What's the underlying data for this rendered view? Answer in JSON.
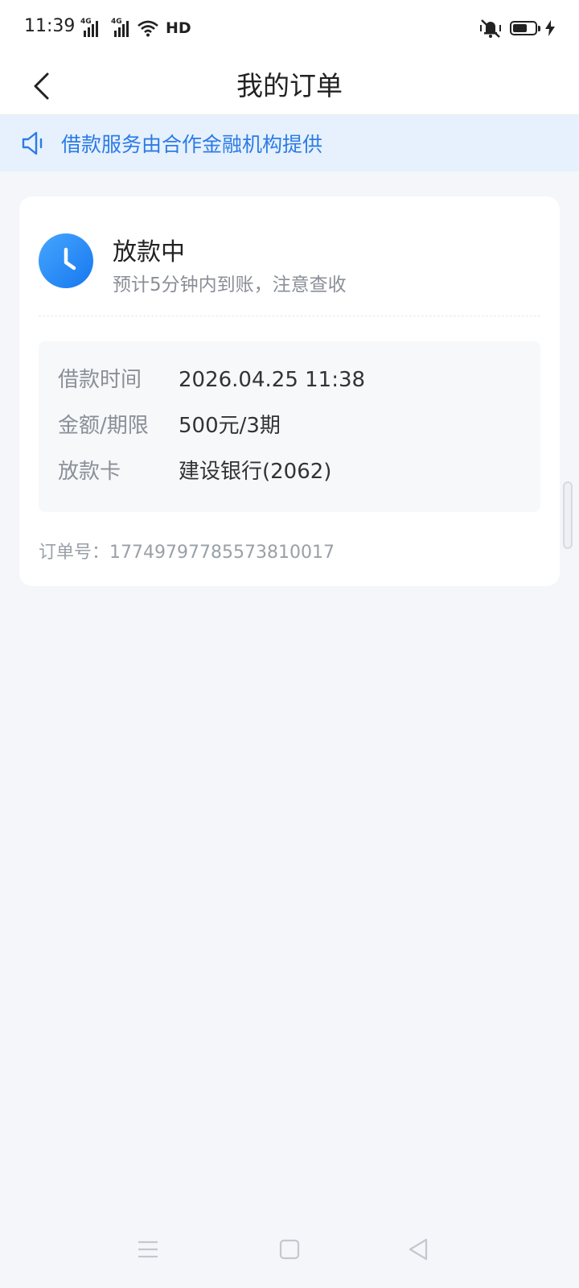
{
  "status_bar": {
    "time": "11:39",
    "network_1": "4G",
    "network_2": "4G",
    "hd": "HD",
    "battery_level": 0.65
  },
  "header": {
    "title": "我的订单"
  },
  "notice": {
    "text": "借款服务由合作金融机构提供"
  },
  "order": {
    "status_title": "放款中",
    "status_subtitle": "预计5分钟内到账，注意查收",
    "details": [
      {
        "label": "借款时间",
        "value": "2026.04.25 11:38"
      },
      {
        "label": "金额/期限",
        "value": "500元/3期"
      },
      {
        "label": "放款卡",
        "value": "建设银行(2062)"
      }
    ],
    "order_number": "订单号：17749797785573810017"
  },
  "colors": {
    "accent": "#1677ef",
    "notice_bg": "#e6f1fd",
    "page_bg": "#f4f6f9"
  }
}
